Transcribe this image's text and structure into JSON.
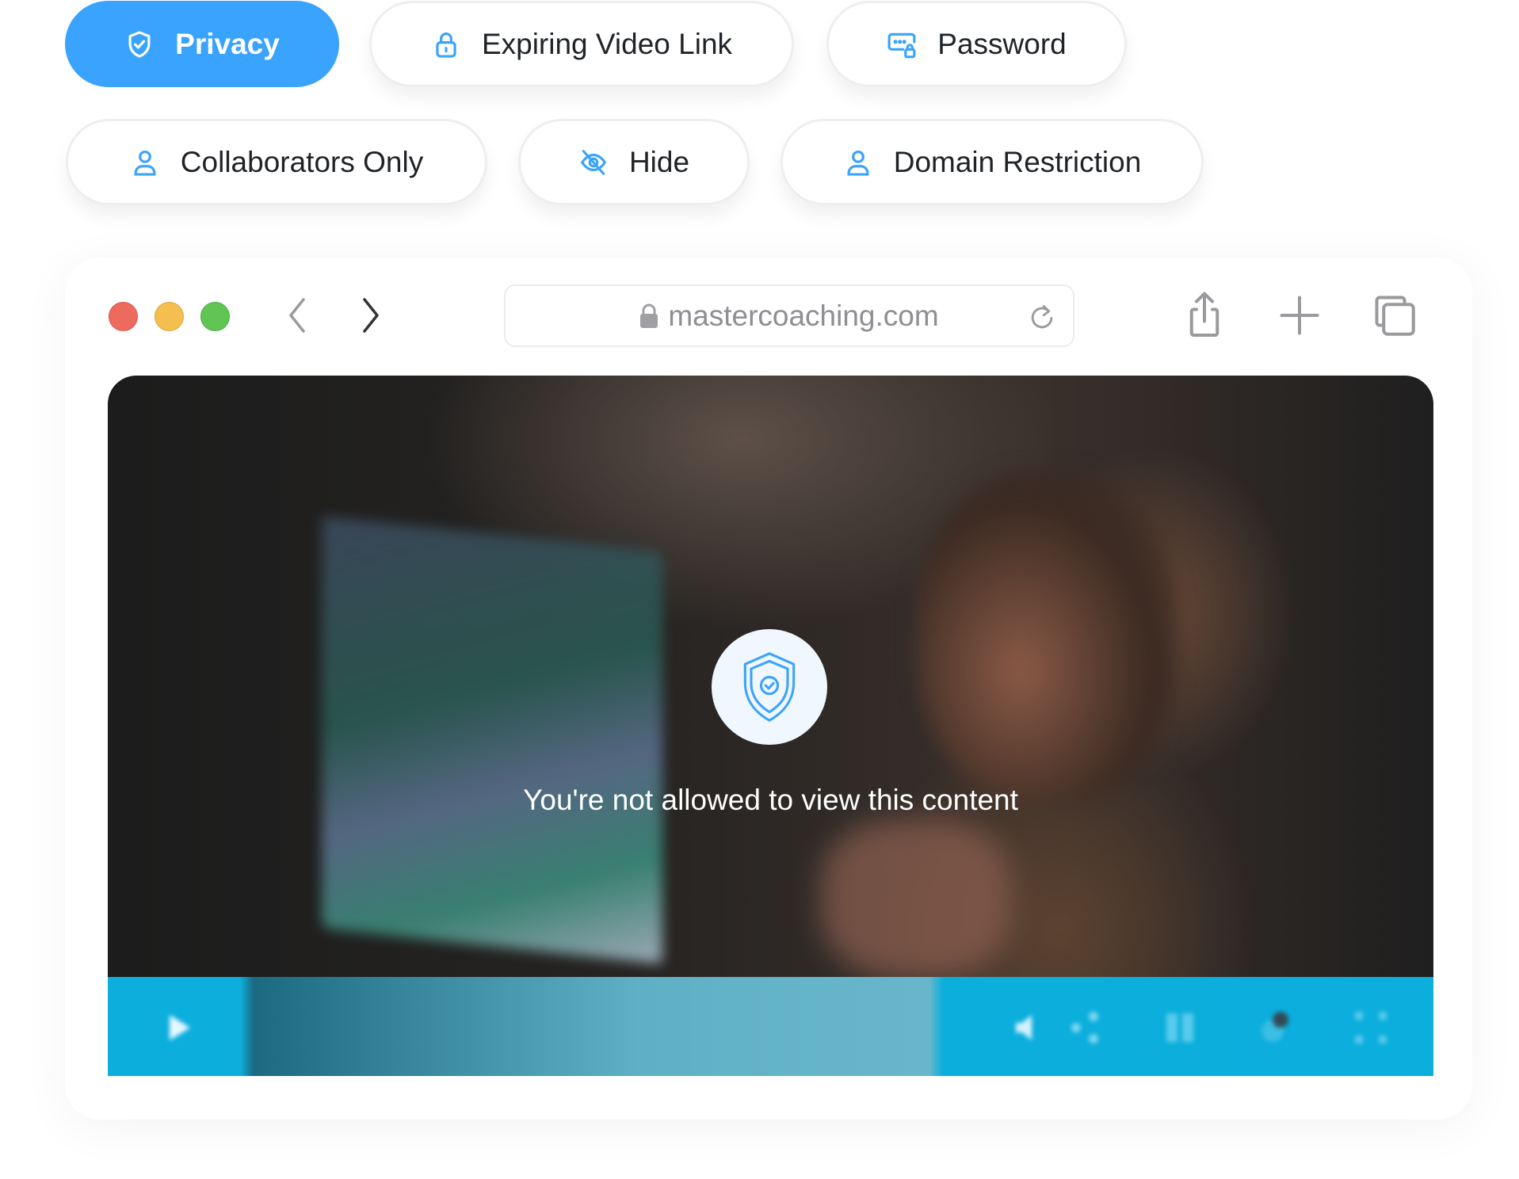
{
  "filters": [
    {
      "label": "Privacy",
      "icon": "shield-check-icon",
      "active": true
    },
    {
      "label": "Expiring Video Link",
      "icon": "lock-icon",
      "active": false
    },
    {
      "label": "Password",
      "icon": "password-field-icon",
      "active": false
    },
    {
      "label": "Collaborators Only",
      "icon": "user-icon",
      "active": false
    },
    {
      "label": "Hide",
      "icon": "eye-off-icon",
      "active": false
    },
    {
      "label": "Domain Restriction",
      "icon": "user-icon",
      "active": false
    }
  ],
  "browser": {
    "url": "mastercoaching.com",
    "traffic_lights": {
      "close": "#ed6a5e",
      "minimize": "#f5bf4f",
      "zoom": "#61c554"
    }
  },
  "player": {
    "blocked_message": "You're not allowed to view this content",
    "accent_color": "#0caedc",
    "controls": [
      "play-icon",
      "volume-icon",
      "share-icon",
      "chapters-icon",
      "captions-icon",
      "fullscreen-icon"
    ]
  },
  "colors": {
    "primary": "#3aa3fd",
    "icon_blue": "#3aa3fd",
    "text": "#1f2328",
    "muted": "#8e8e93"
  }
}
